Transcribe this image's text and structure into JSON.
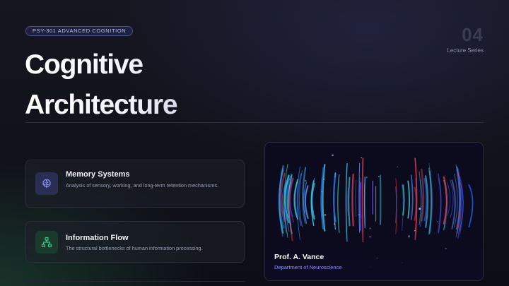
{
  "header": {
    "course_badge": "PSY-301 ADVANCED COGNITION",
    "title": "Cognitive Architecture",
    "lecture_number": "04",
    "lecture_label": "Lecture Series"
  },
  "cards": [
    {
      "title": "Memory Systems",
      "description": "Analysis of sensory, working, and long-term retention mechanisms.",
      "icon": "brain-icon",
      "accent": "#8f93ff"
    },
    {
      "title": "Information Flow",
      "description": "The structural bottlenecks of human information processing.",
      "icon": "network-diagram-icon",
      "accent": "#36c98a"
    }
  ],
  "presenter": {
    "name": "Prof. A. Vance",
    "department": "Department of Neuroscience"
  },
  "colors": {
    "background": "#12131b",
    "card_border": "#2b2e3a",
    "link_accent": "#8f93ff"
  }
}
